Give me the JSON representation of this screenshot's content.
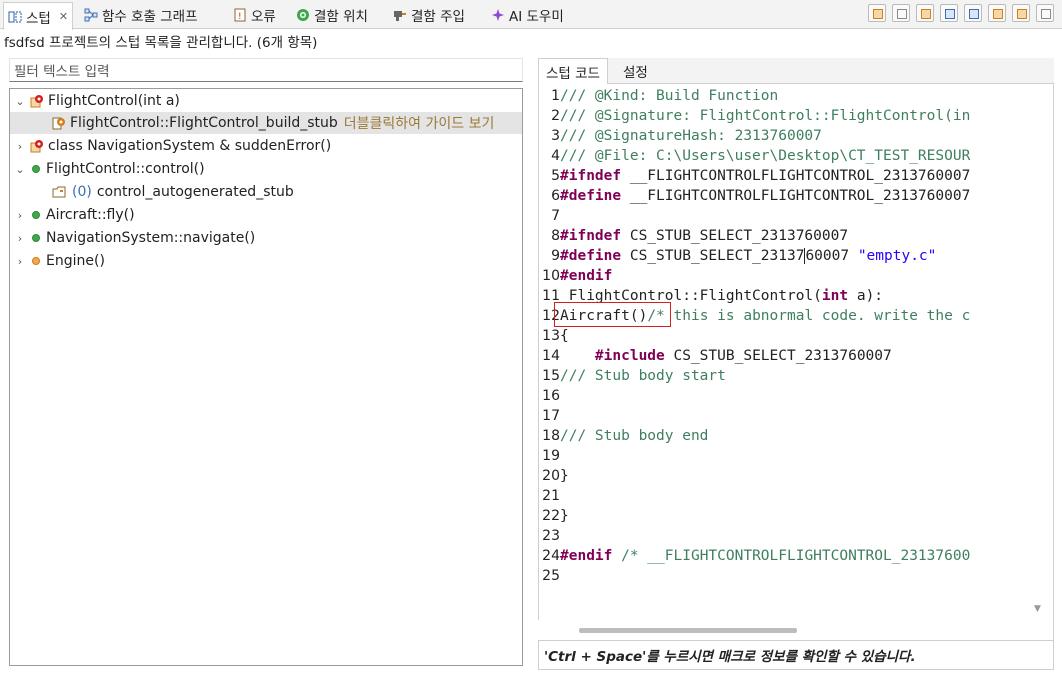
{
  "tabs": [
    {
      "label": "스텁",
      "icon": "stub-icon",
      "active": true
    },
    {
      "label": "함수 호출 그래프",
      "icon": "call-graph-icon"
    },
    {
      "label": "오류",
      "icon": "error-icon"
    },
    {
      "label": "결함 위치",
      "icon": "defect-location-icon"
    },
    {
      "label": "결함 주입",
      "icon": "fault-injection-icon"
    },
    {
      "label": "AI 도우미",
      "icon": "ai-assistant-icon"
    }
  ],
  "tab_close": "✕",
  "subtitle": "fsdfsd 프로젝트의 스텁 목록을 관리합니다. (6개 항목)",
  "filter": {
    "placeholder": "필터 텍스트 입력"
  },
  "tree": [
    {
      "label": "FlightControl(int a)",
      "expanded": true,
      "icon": "stub-gear-icon"
    },
    {
      "label": "FlightControl::FlightControl_build_stub",
      "hint": "더블클릭하여 가이드 보기",
      "selected": true,
      "icon": "stub-file-icon"
    },
    {
      "label": "class NavigationSystem & suddenError()",
      "expanded": false,
      "icon": "stub-gear-icon"
    },
    {
      "label": "FlightControl::control()",
      "expanded": true,
      "icon": "green-dot-icon"
    },
    {
      "count": "(0)",
      "label": "control_autogenerated_stub",
      "icon": "stub-folder-icon"
    },
    {
      "label": "Aircraft::fly()",
      "expanded": false,
      "icon": "green-dot-icon"
    },
    {
      "label": "NavigationSystem::navigate()",
      "expanded": false,
      "icon": "green-dot-icon"
    },
    {
      "label": "Engine()",
      "expanded": false,
      "icon": "orange-dot-icon"
    }
  ],
  "right_tabs": [
    "스텁 코드",
    "설정"
  ],
  "code_lines": [
    {
      "n": "1",
      "parts": [
        {
          "c": "cm",
          "t": "/// @Kind: Build Function"
        }
      ]
    },
    {
      "n": "2",
      "parts": [
        {
          "c": "cm",
          "t": "/// @Signature: FlightControl::FlightControl(in"
        }
      ]
    },
    {
      "n": "3",
      "parts": [
        {
          "c": "cm",
          "t": "/// @SignatureHash: 2313760007"
        }
      ]
    },
    {
      "n": "4",
      "parts": [
        {
          "c": "cm",
          "t": "/// @File: C:\\Users\\user\\Desktop\\CT_TEST_RESOUR"
        }
      ]
    },
    {
      "n": "5",
      "parts": [
        {
          "c": "kw",
          "t": "#ifndef"
        },
        {
          "c": "plain",
          "t": " __FLIGHTCONTROLFLIGHTCONTROL_2313760007"
        }
      ]
    },
    {
      "n": "6",
      "parts": [
        {
          "c": "kw",
          "t": "#define"
        },
        {
          "c": "plain",
          "t": " __FLIGHTCONTROLFLIGHTCONTROL_2313760007"
        }
      ]
    },
    {
      "n": "7",
      "parts": []
    },
    {
      "n": "8",
      "parts": [
        {
          "c": "kw",
          "t": "#ifndef"
        },
        {
          "c": "plain",
          "t": " CS_STUB_SELECT_2313760007"
        }
      ]
    },
    {
      "n": "9",
      "parts": [
        {
          "c": "kw",
          "t": "#define"
        },
        {
          "c": "plain",
          "t": " CS_STUB_SELECT_23137"
        },
        {
          "c": "cursor",
          "t": ""
        },
        {
          "c": "plain",
          "t": "60007 "
        },
        {
          "c": "str",
          "t": "\"empty.c\""
        }
      ]
    },
    {
      "n": "10",
      "parts": [
        {
          "c": "kw",
          "t": "#endif"
        }
      ]
    },
    {
      "n": "11",
      "parts": [
        {
          "c": "plain",
          "t": " FlightControl::FlightControl("
        },
        {
          "c": "kw",
          "t": "int"
        },
        {
          "c": "plain",
          "t": " a):"
        }
      ]
    },
    {
      "n": "12",
      "parts": [
        {
          "c": "plain",
          "t": "Aircraft()"
        },
        {
          "c": "cm",
          "t": "/* this is abnormal code. write the c"
        }
      ]
    },
    {
      "n": "13",
      "parts": [
        {
          "c": "plain",
          "t": "{"
        }
      ]
    },
    {
      "n": "14",
      "parts": [
        {
          "c": "plain",
          "t": "    "
        },
        {
          "c": "kw",
          "t": "#include"
        },
        {
          "c": "plain",
          "t": " CS_STUB_SELECT_2313760007"
        }
      ]
    },
    {
      "n": "15",
      "parts": [
        {
          "c": "cm",
          "t": "/// Stub body start"
        }
      ]
    },
    {
      "n": "16",
      "parts": []
    },
    {
      "n": "17",
      "parts": []
    },
    {
      "n": "18",
      "parts": [
        {
          "c": "cm",
          "t": "/// Stub body end"
        }
      ]
    },
    {
      "n": "19",
      "parts": []
    },
    {
      "n": "20",
      "parts": [
        {
          "c": "plain",
          "t": "}"
        }
      ]
    },
    {
      "n": "21",
      "parts": []
    },
    {
      "n": "22",
      "parts": [
        {
          "c": "plain",
          "t": "}"
        }
      ]
    },
    {
      "n": "23",
      "parts": []
    },
    {
      "n": "24",
      "parts": [
        {
          "c": "kw",
          "t": "#endif"
        },
        {
          "c": "cm",
          "t": " /* __FLIGHTCONTROLFLIGHTCONTROL_23137600"
        }
      ]
    },
    {
      "n": "25",
      "parts": []
    }
  ],
  "status": "'Ctrl + Space'를 누르시면 매크로 정보를 확인할 수 있습니다.",
  "colors": {
    "comment": "#3f7f5f",
    "keyword": "#7f0055",
    "string": "#2a00ff",
    "highlight_box": "#d62020"
  }
}
